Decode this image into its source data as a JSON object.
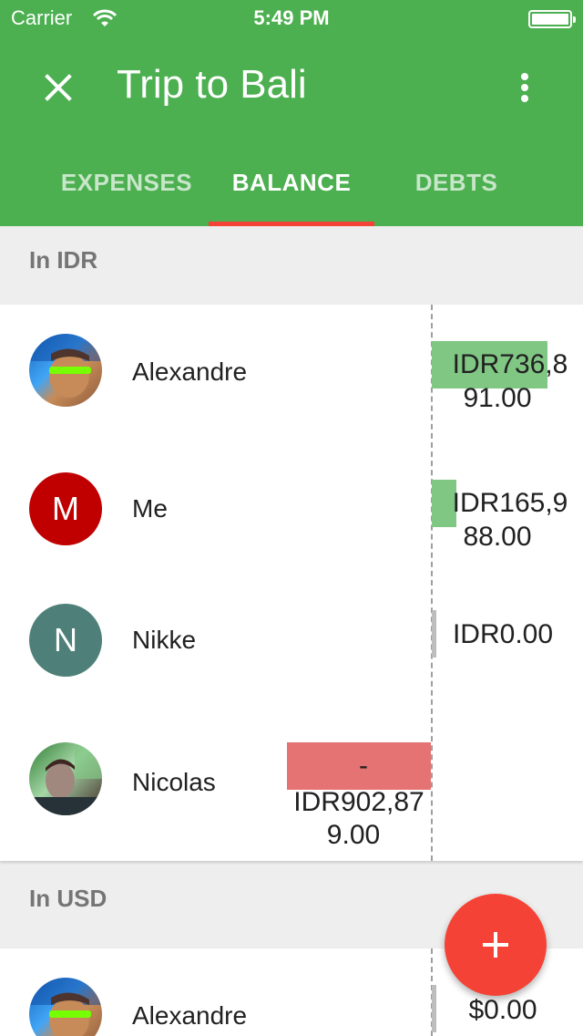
{
  "status_bar": {
    "carrier": "Carrier",
    "time": "5:49 PM"
  },
  "header": {
    "title": "Trip to Bali"
  },
  "tabs": [
    {
      "label": "EXPENSES",
      "active": false
    },
    {
      "label": "BALANCE",
      "active": true
    },
    {
      "label": "DEBTS",
      "active": false
    }
  ],
  "sections": [
    {
      "header": "In IDR",
      "rows": [
        {
          "name": "Alexandre",
          "avatar": "photo",
          "amount_line1": "IDR736,8",
          "amount_line2": "91.00",
          "sign": "positive"
        },
        {
          "name": "Me",
          "avatar_letter": "M",
          "avatar_color": "#c00000",
          "amount_line1": "IDR165,9",
          "amount_line2": "88.00",
          "sign": "positive"
        },
        {
          "name": "Nikke",
          "avatar_letter": "N",
          "avatar_color": "#4e8079",
          "amount_line1": "IDR0.00",
          "sign": "zero"
        },
        {
          "name": "Nicolas",
          "avatar": "photo",
          "amount_line1": "-",
          "amount_line2": "IDR902,87",
          "amount_line3": "9.00",
          "sign": "negative"
        }
      ]
    },
    {
      "header": "In USD",
      "rows": [
        {
          "name": "Alexandre",
          "avatar": "photo",
          "amount_line1": "$0.00",
          "sign": "zero"
        }
      ]
    }
  ],
  "fab": {
    "icon": "plus-icon"
  },
  "colors": {
    "primary": "#4caf50",
    "accent": "#f44336",
    "positive": "#81c784",
    "negative": "#e57373"
  }
}
